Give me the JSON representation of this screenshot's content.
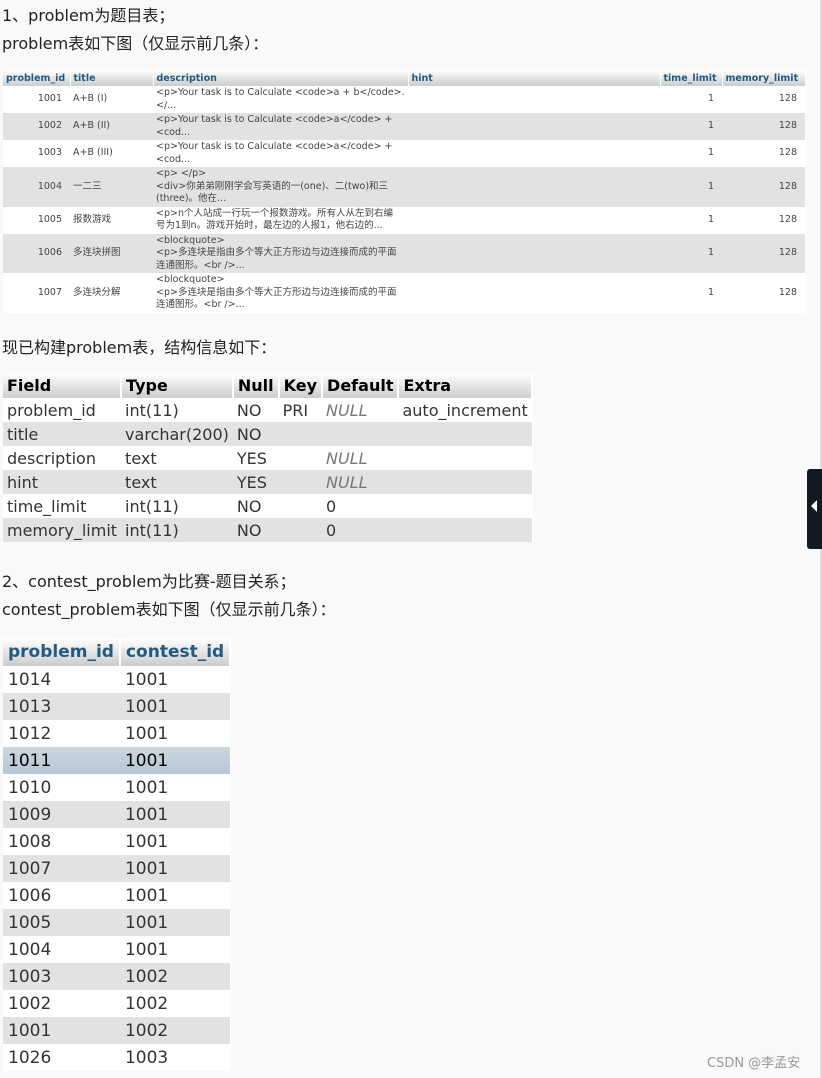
{
  "intro": {
    "line1": "1、problem为题目表；",
    "line2": "problem表如下图（仅显示前几条）："
  },
  "problem_table": {
    "headers": [
      "problem_id",
      "title",
      "description",
      "hint",
      "time_limit",
      "memory_limit"
    ],
    "rows": [
      [
        "1001",
        "A+B (I)",
        "<p>Your task is to Calculate <code>a + b</code>.\n</...",
        "",
        "1",
        "128"
      ],
      [
        "1002",
        "A+B (II)",
        "<p>Your task is to Calculate <code>a</code> +\n<cod...",
        "",
        "1",
        "128"
      ],
      [
        "1003",
        "A+B (III)",
        "<p>Your task is to Calculate <code>a</code> +\n<cod...",
        "",
        "1",
        "128"
      ],
      [
        "1004",
        "一二三",
        "<p> </p>\n<div>你弟弟刚刚学会写英语的一(one)、二(two)和三\n(three)。他在...",
        "",
        "1",
        "128"
      ],
      [
        "1005",
        "报数游戏",
        "<p>n个人站成一行玩一个报数游戏。所有人从左到右编\n号为1到n。游戏开始时，最左边的人报1，他右边的...",
        "",
        "1",
        "128"
      ],
      [
        "1006",
        "多连块拼图",
        "<blockquote>\n<p>多连块是指由多个等大正方形边与边连接而成的平面\n连通图形。<br />...",
        "",
        "1",
        "128"
      ],
      [
        "1007",
        "多连块分解",
        "<blockquote>\n<p>多连块是指由多个等大正方形边与边连接而成的平面\n连通图形。<br />...",
        "",
        "1",
        "128"
      ]
    ]
  },
  "structure_intro": "现已构建problem表，结构信息如下：",
  "structure_table": {
    "headers": [
      "Field",
      "Type",
      "Null",
      "Key",
      "Default",
      "Extra"
    ],
    "rows": [
      [
        "problem_id",
        "int(11)",
        "NO",
        "PRI",
        "NULL",
        "auto_increment"
      ],
      [
        "title",
        "varchar(200)",
        "NO",
        "",
        "",
        ""
      ],
      [
        "description",
        "text",
        "YES",
        "",
        "NULL",
        ""
      ],
      [
        "hint",
        "text",
        "YES",
        "",
        "NULL",
        ""
      ],
      [
        "time_limit",
        "int(11)",
        "NO",
        "",
        "0",
        ""
      ],
      [
        "memory_limit",
        "int(11)",
        "NO",
        "",
        "0",
        ""
      ]
    ]
  },
  "section2": {
    "line1": "2、contest_problem为比赛-题目关系；",
    "line2": "contest_problem表如下图（仅显示前几条）："
  },
  "contest_table": {
    "headers": [
      "problem_id",
      "contest_id"
    ],
    "highlighted_row": 3,
    "rows": [
      [
        "1014",
        "1001"
      ],
      [
        "1013",
        "1001"
      ],
      [
        "1012",
        "1001"
      ],
      [
        "1011",
        "1001"
      ],
      [
        "1010",
        "1001"
      ],
      [
        "1009",
        "1001"
      ],
      [
        "1008",
        "1001"
      ],
      [
        "1007",
        "1001"
      ],
      [
        "1006",
        "1001"
      ],
      [
        "1005",
        "1001"
      ],
      [
        "1004",
        "1001"
      ],
      [
        "1003",
        "1002"
      ],
      [
        "1002",
        "1002"
      ],
      [
        "1001",
        "1002"
      ],
      [
        "1026",
        "1003"
      ]
    ]
  },
  "watermark": "CSDN @李孟安",
  "colors": {
    "header_text": "#235a81",
    "row_alt": "#e2e2e2",
    "row_highlight": "#c4d0dc",
    "side_tab": "#111a22"
  },
  "icons": {
    "side_tab": "caret-left-icon"
  }
}
